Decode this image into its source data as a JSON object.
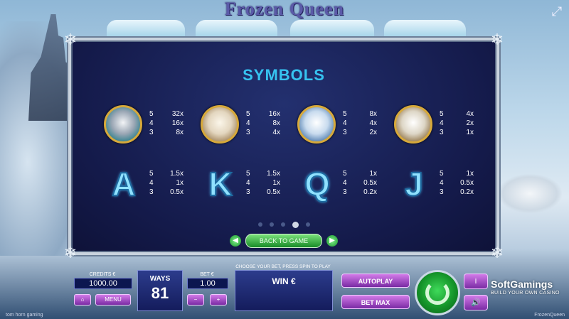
{
  "game": {
    "title": "Frozen Queen",
    "fullscreen_icon": "expand-icon"
  },
  "paytable": {
    "title": "SYMBOLS",
    "symbols": [
      {
        "icon": "white-tiger",
        "pays": [
          {
            "n": "5",
            "m": "32x"
          },
          {
            "n": "4",
            "m": "16x"
          },
          {
            "n": "3",
            "m": "8x"
          }
        ]
      },
      {
        "icon": "polar-bear",
        "pays": [
          {
            "n": "5",
            "m": "16x"
          },
          {
            "n": "4",
            "m": "8x"
          },
          {
            "n": "3",
            "m": "4x"
          }
        ]
      },
      {
        "icon": "arctic-fox",
        "pays": [
          {
            "n": "5",
            "m": "8x"
          },
          {
            "n": "4",
            "m": "4x"
          },
          {
            "n": "3",
            "m": "2x"
          }
        ]
      },
      {
        "icon": "snowy-owl",
        "pays": [
          {
            "n": "5",
            "m": "4x"
          },
          {
            "n": "4",
            "m": "2x"
          },
          {
            "n": "3",
            "m": "1x"
          }
        ]
      },
      {
        "letter": "A",
        "pays": [
          {
            "n": "5",
            "m": "1.5x"
          },
          {
            "n": "4",
            "m": "1x"
          },
          {
            "n": "3",
            "m": "0.5x"
          }
        ]
      },
      {
        "letter": "K",
        "pays": [
          {
            "n": "5",
            "m": "1.5x"
          },
          {
            "n": "4",
            "m": "1x"
          },
          {
            "n": "3",
            "m": "0.5x"
          }
        ]
      },
      {
        "letter": "Q",
        "pays": [
          {
            "n": "5",
            "m": "1x"
          },
          {
            "n": "4",
            "m": "0.5x"
          },
          {
            "n": "3",
            "m": "0.2x"
          }
        ]
      },
      {
        "letter": "J",
        "pays": [
          {
            "n": "5",
            "m": "1x"
          },
          {
            "n": "4",
            "m": "0.5x"
          },
          {
            "n": "3",
            "m": "0.2x"
          }
        ]
      }
    ],
    "page_count": 5,
    "active_page": 4,
    "back_label": "BACK TO GAME"
  },
  "bottom_bar": {
    "credits_label": "CREDITS €",
    "credits_value": "1000.00",
    "menu_label": "MENU",
    "ways_label": "WAYS",
    "ways_value": "81",
    "bet_label": "BET €",
    "bet_value": "1.00",
    "minus": "−",
    "plus": "+",
    "prompt": "CHOOSE YOUR BET, PRESS SPIN TO PLAY",
    "win_label": "WIN €",
    "autoplay_label": "AUTOPLAY",
    "betmax_label": "BET MAX",
    "info_label": "i",
    "sound_icon": "speaker-icon"
  },
  "branding": {
    "logo": "SoftGamings",
    "tagline": "BUILD YOUR OWN CASINO",
    "footer_left": "tom horn gaming",
    "footer_right": "FrozenQueen"
  },
  "colors": {
    "accent": "#36c3f0",
    "button": "#a24fc9",
    "spin": "#1fae3a",
    "panel": "#141a4a"
  }
}
